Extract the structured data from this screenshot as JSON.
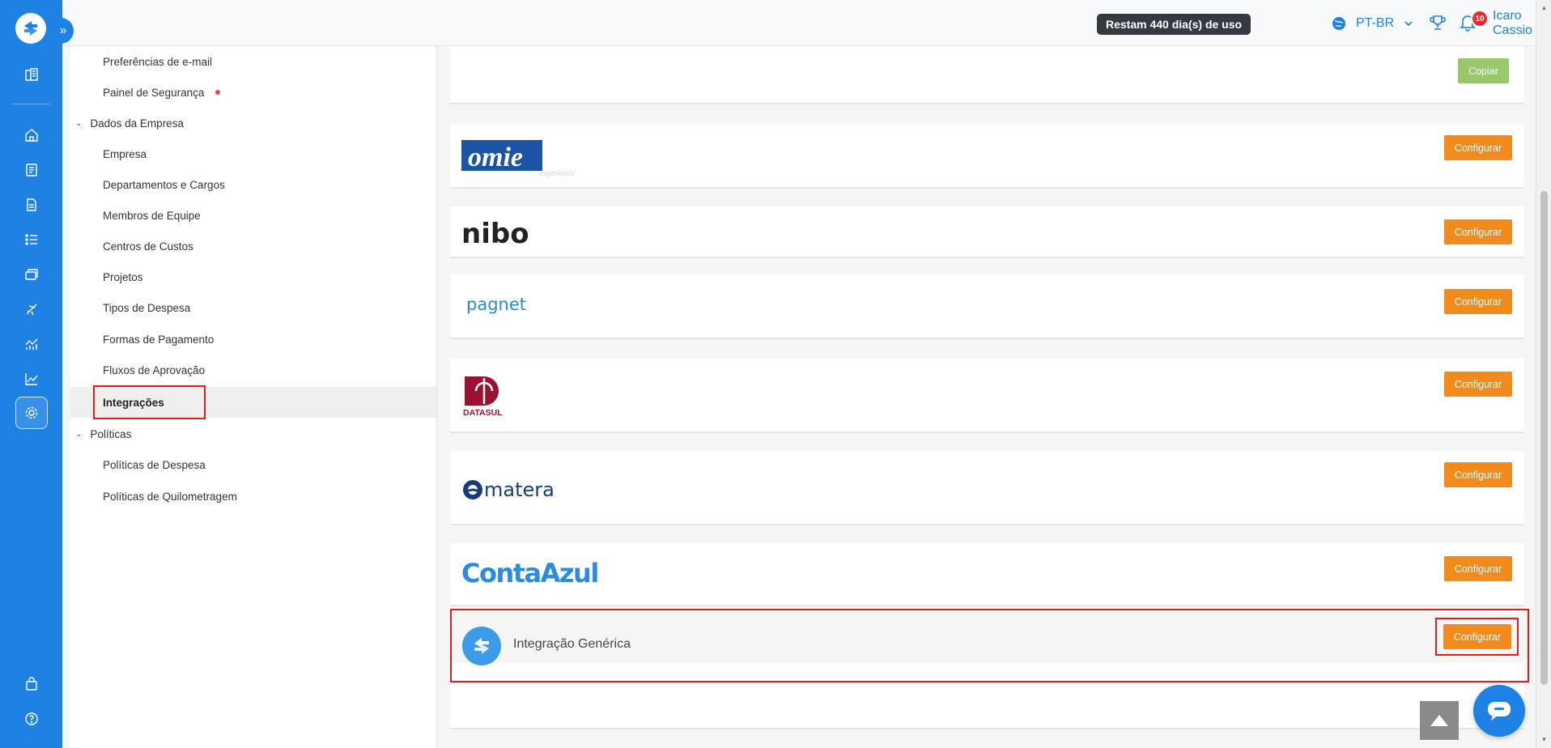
{
  "topbar": {
    "trial_badge": "Restam 440 dia(s) de uso",
    "language": "PT-BR",
    "notifications_count": "10",
    "user_name": "Icaro Cassio"
  },
  "rail": {
    "icons": [
      "company-icon",
      "home-icon",
      "report-icon",
      "document-icon",
      "checklist-icon",
      "cards-icon",
      "travel-icon",
      "analytics-icon",
      "chart-icon",
      "settings-icon",
      "store-icon",
      "help-icon"
    ],
    "active": "settings-icon"
  },
  "submenu": {
    "items": [
      {
        "label": "Preferências de e-mail",
        "kind": "child"
      },
      {
        "label": "Painel de Segurança",
        "kind": "child",
        "dot": true
      },
      {
        "label": "Dados da Empresa",
        "kind": "group"
      },
      {
        "label": "Empresa",
        "kind": "child"
      },
      {
        "label": "Departamentos e Cargos",
        "kind": "child"
      },
      {
        "label": "Membros de Equipe",
        "kind": "child"
      },
      {
        "label": "Centros de Custos",
        "kind": "child"
      },
      {
        "label": "Projetos",
        "kind": "child"
      },
      {
        "label": "Tipos de Despesa",
        "kind": "child"
      },
      {
        "label": "Formas de Pagamento",
        "kind": "child"
      },
      {
        "label": "Fluxos de Aprovação",
        "kind": "child"
      },
      {
        "label": "Integrações",
        "kind": "child",
        "active": true
      },
      {
        "label": "Políticas",
        "kind": "group"
      },
      {
        "label": "Políticas de Despesa",
        "kind": "child"
      },
      {
        "label": "Políticas de Quilometragem",
        "kind": "child"
      }
    ]
  },
  "integrations": {
    "copy_label": "Copiar",
    "configure_label": "Configurar",
    "cards": [
      {
        "id": "omie",
        "logo_text": "omie",
        "logo_subtext": "experience",
        "brand_color": "#1c54a5"
      },
      {
        "id": "nibo",
        "logo_text": "nibo",
        "brand_color": "#222222",
        "accent_color": "#2f93d8"
      },
      {
        "id": "pagnet",
        "logo_text": "pagnet",
        "brand_color": "#2b8bc9"
      },
      {
        "id": "datasul",
        "logo_text": "DATASUL",
        "brand_color": "#9b1230"
      },
      {
        "id": "matera",
        "logo_text": "matera",
        "brand_color": "#173d7a"
      },
      {
        "id": "contaazul",
        "logo_text": "ContaAzul",
        "brand_color": "#2a8be0"
      },
      {
        "id": "generic",
        "label": "Integração Genérica",
        "brand_color": "#3d9be9"
      }
    ]
  },
  "colors": {
    "primary": "#1e82e4",
    "configure_button": "#f38b1c",
    "copy_button": "#98c86a",
    "highlight": "#e01e1e"
  }
}
